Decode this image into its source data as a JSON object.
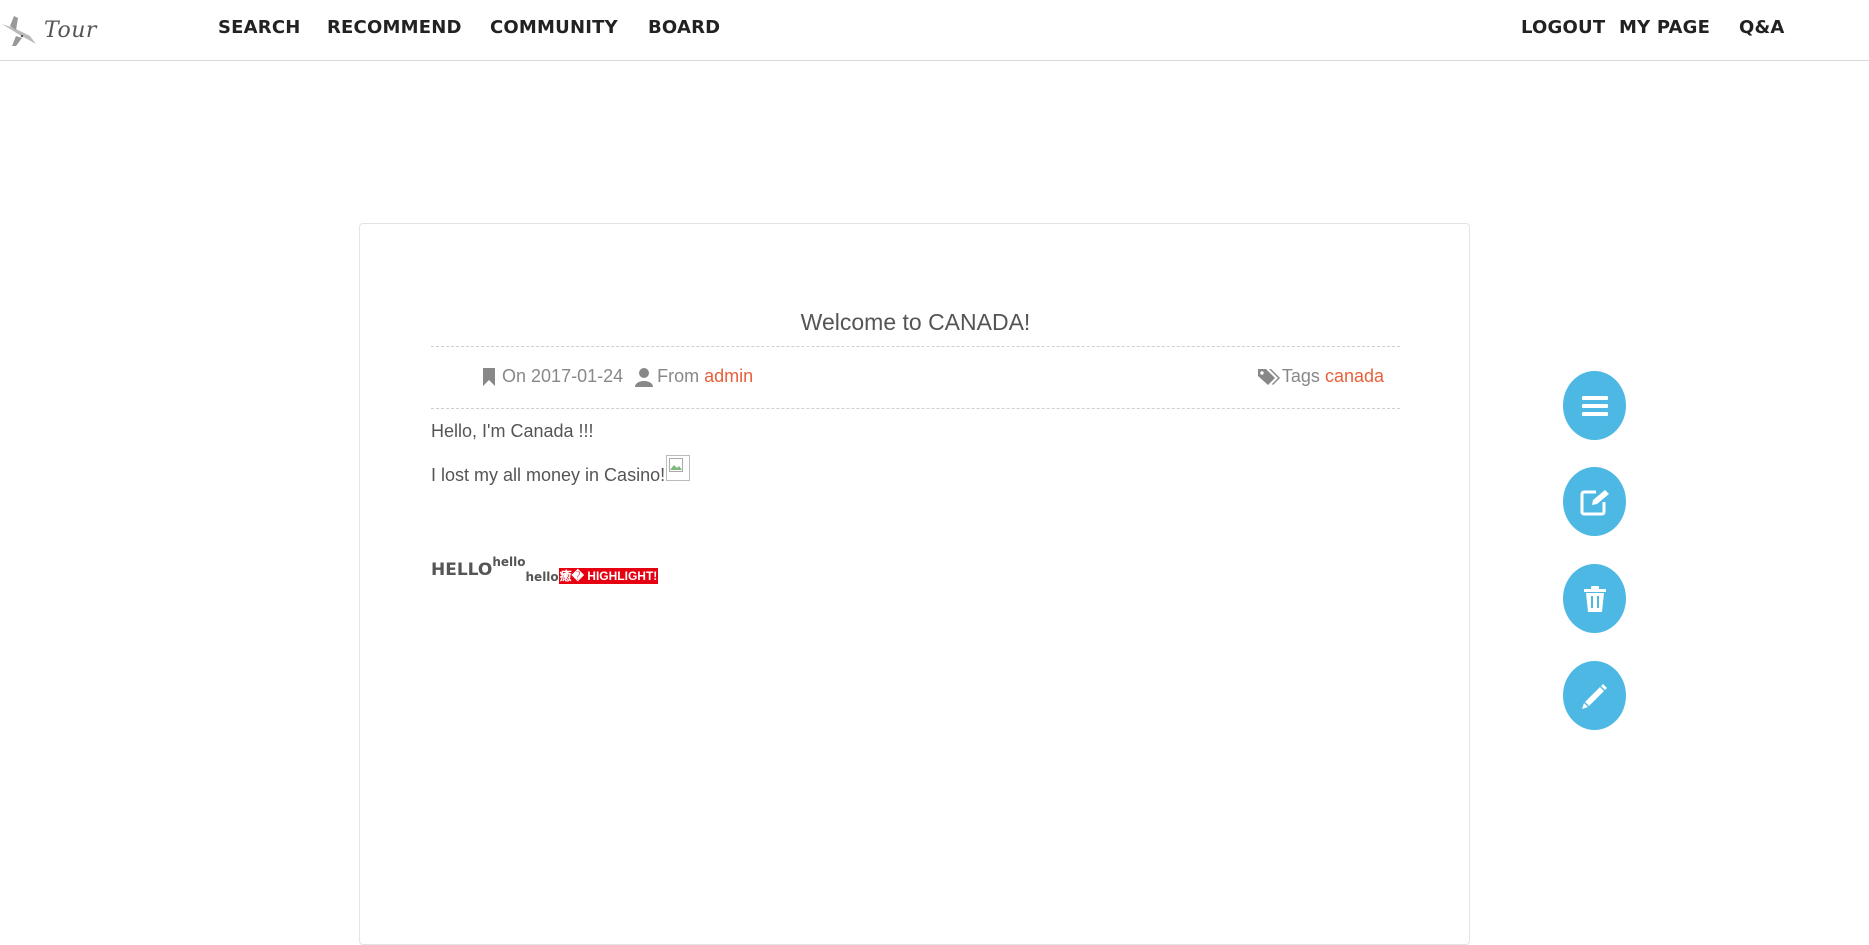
{
  "navbar": {
    "logo_text": "Tour",
    "left_items": [
      "SEARCH",
      "RECOMMEND",
      "COMMUNITY",
      "BOARD"
    ],
    "right_items": [
      "LOGOUT",
      "MY PAGE",
      "Q&A"
    ]
  },
  "post": {
    "title": "Welcome to CANADA!",
    "date_prefix": "On",
    "date": "2017-01-24",
    "author_prefix": "From",
    "author": "admin",
    "tags_prefix": "Tags",
    "tag": "canada",
    "paragraph1": "Hello, I'm Canada !!!",
    "paragraph2": "I lost my all money in Casino!",
    "hello_big": "HELLO",
    "hello_sup": "hello",
    "hello_sub": "hello",
    "highlight": "癒� HIGHLIGHT!"
  },
  "actions": [
    {
      "name": "list-button",
      "icon": "list-icon"
    },
    {
      "name": "edit-square-button",
      "icon": "edit-square-icon"
    },
    {
      "name": "delete-button",
      "icon": "trash-icon"
    },
    {
      "name": "write-button",
      "icon": "pencil-icon"
    }
  ],
  "colors": {
    "accent": "#e8603c",
    "fab": "#4db8e3",
    "highlight_bg": "#e60012"
  }
}
